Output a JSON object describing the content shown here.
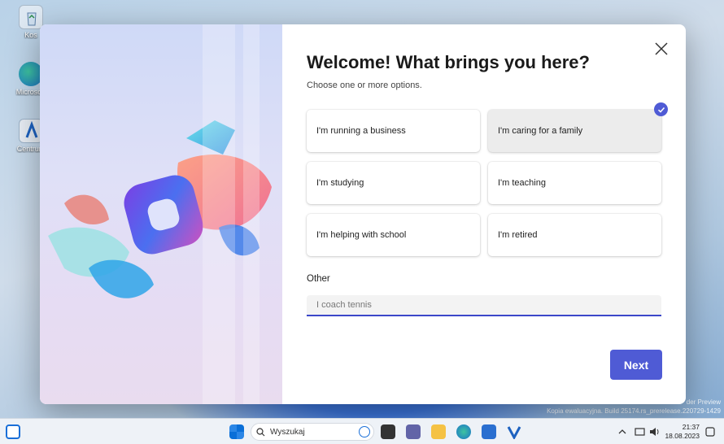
{
  "desktop": {
    "icons": [
      {
        "label": "Kos"
      },
      {
        "label": "Microsoft"
      },
      {
        "label": "Centrum"
      }
    ],
    "watermark": {
      "line1": "der Preview",
      "line2": "Kopia ewaluacyjna. Build 25174.rs_prerelease.220729-1429"
    }
  },
  "dialog": {
    "title": "Welcome! What brings you here?",
    "subtitle": "Choose one or more options.",
    "close_icon": "close-icon",
    "options": [
      {
        "label": "I'm running a business",
        "selected": false
      },
      {
        "label": "I'm caring for a family",
        "selected": true
      },
      {
        "label": "I'm studying",
        "selected": false
      },
      {
        "label": "I'm teaching",
        "selected": false
      },
      {
        "label": "I'm helping with school",
        "selected": false
      },
      {
        "label": "I'm retired",
        "selected": false
      }
    ],
    "other": {
      "label": "Other",
      "placeholder": "I coach tennis"
    },
    "next_label": "Next",
    "accent_color": "#4f5bd5"
  },
  "taskbar": {
    "search_placeholder": "Wyszukaj",
    "time": "21:37",
    "date": "18.08.2023",
    "icons": [
      "widgets-icon",
      "start-icon",
      "search-icon",
      "bing-icon",
      "task-view-icon",
      "teams-icon",
      "file-explorer-icon",
      "edge-icon",
      "store-icon",
      "app-icon",
      "chevron-up-icon",
      "network-icon",
      "volume-icon",
      "notification-icon"
    ]
  }
}
